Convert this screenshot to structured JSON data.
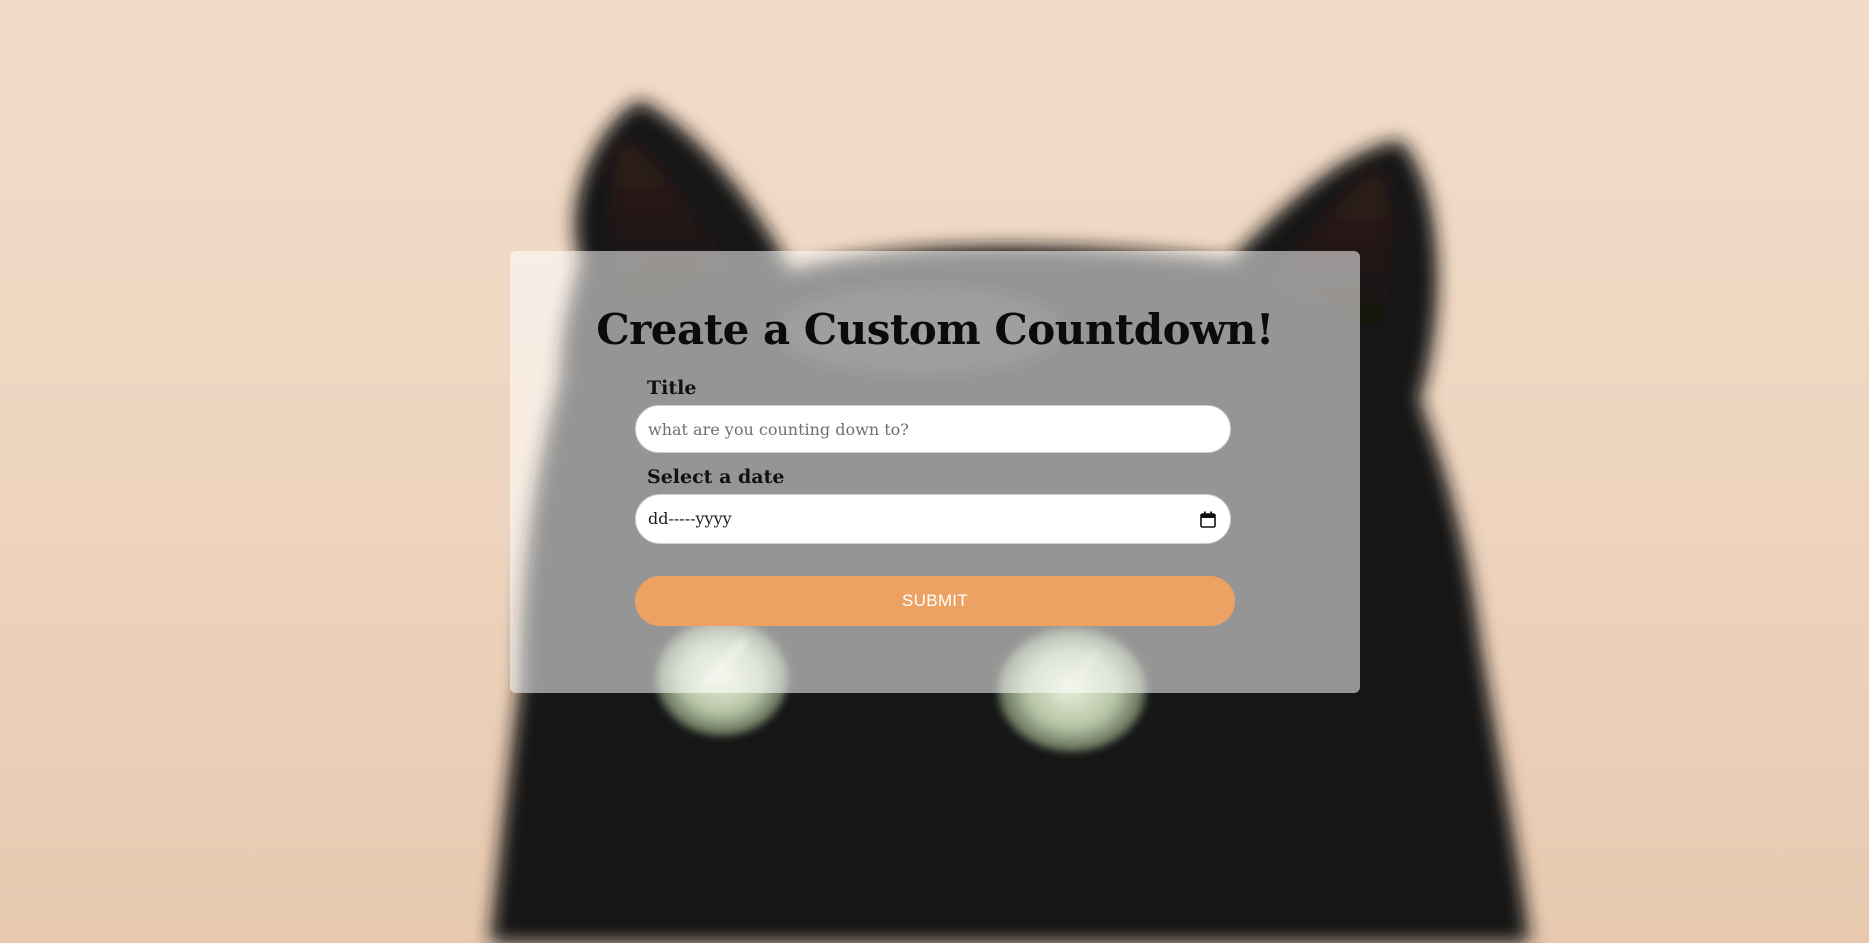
{
  "background": {
    "image": "black-cat-photo",
    "wall_color": "#efd6c1",
    "cat_color": "#151515"
  },
  "form": {
    "heading": "Create a Custom Countdown!",
    "title_label": "Title",
    "title_placeholder": "what are you counting down to?",
    "title_value": "",
    "date_label": "Select a date",
    "date_placeholder": "dd-----yyyy",
    "date_icon": "calendar-icon",
    "submit_label": "SUBMIT"
  },
  "colors": {
    "accent": "#eca263",
    "card_overlay": "rgba(255,255,255,0.55)"
  }
}
